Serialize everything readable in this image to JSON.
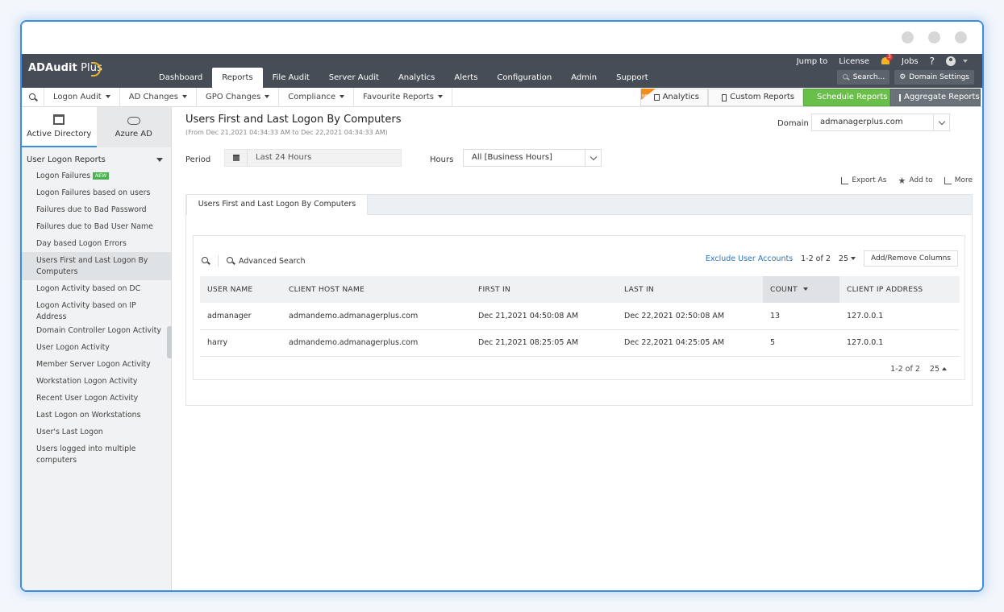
{
  "app": {
    "name": "ADAudit",
    "name_suffix": " Plus"
  },
  "nav": {
    "items": [
      "Dashboard",
      "Reports",
      "File Audit",
      "Server Audit",
      "Analytics",
      "Alerts",
      "Configuration",
      "Admin",
      "Support"
    ],
    "active": "Reports"
  },
  "top": {
    "jump_to": "Jump to",
    "license": "License",
    "notifications": "3",
    "jobs": "Jobs",
    "help": "?",
    "search": "Search...",
    "domain_settings": "Domain Settings"
  },
  "subnav": {
    "menus": [
      "Logon Audit",
      "AD Changes",
      "GPO Changes",
      "Compliance",
      "Favourite Reports"
    ],
    "new_badge": "NEW",
    "analytics": "Analytics",
    "custom_reports": "Custom Reports",
    "schedule_reports": "Schedule Reports",
    "aggregate_reports": "Aggregate Reports"
  },
  "sidebar": {
    "tabs": [
      "Active Directory",
      "Azure AD"
    ],
    "section": "User Logon Reports",
    "new_tag": "NEW",
    "items": [
      "Logon Failures",
      "Logon Failures based on users",
      "Failures due to Bad Password",
      "Failures due to Bad User Name",
      "Day based Logon Errors",
      "Users First and Last Logon By Computers",
      "Logon Activity based on DC",
      "Logon Activity based on IP Address",
      "Domain Controller Logon Activity",
      "User Logon Activity",
      "Member Server Logon Activity",
      "Workstation Logon Activity",
      "Recent User Logon Activity",
      "Last Logon on Workstations",
      "User's Last Logon",
      "Users logged into multiple computers"
    ]
  },
  "report": {
    "title": "Users First and Last Logon By Computers",
    "subtitle": "(From Dec 21,2021 04:34:33 AM to Dec 22,2021 04:34:33 AM)",
    "domain_label": "Domain",
    "domain_value": "admanagerplus.com",
    "period_label": "Period",
    "period_value": "Last 24 Hours",
    "hours_label": "Hours",
    "hours_value": "All [Business Hours]",
    "export_as": "Export As",
    "add_to": "Add to",
    "more": "More",
    "tab": "Users First and Last Logon By Computers",
    "advanced_search": "Advanced Search",
    "exclude_user_accounts": "Exclude User Accounts",
    "pagination": "1-2 of 2",
    "page_size": "25",
    "add_remove_columns": "Add/Remove Columns"
  },
  "table": {
    "columns": [
      "USER NAME",
      "CLIENT HOST NAME",
      "FIRST IN",
      "LAST IN",
      "COUNT",
      "CLIENT IP ADDRESS"
    ],
    "rows": [
      [
        "admanager",
        "admandemo.admanagerplus.com",
        "Dec 21,2021 04:50:08 AM",
        "Dec 22,2021 02:50:08 AM",
        "13",
        "127.0.0.1"
      ],
      [
        "harry",
        "admandemo.admanagerplus.com",
        "Dec 21,2021 08:25:05 AM",
        "Dec 22,2021 04:25:05 AM",
        "5",
        "127.0.0.1"
      ]
    ]
  },
  "colors": {
    "accent": "#3b8de0",
    "topbar": "#474d57",
    "schedule_green": "#6abf4b",
    "link": "#2a75bb"
  }
}
